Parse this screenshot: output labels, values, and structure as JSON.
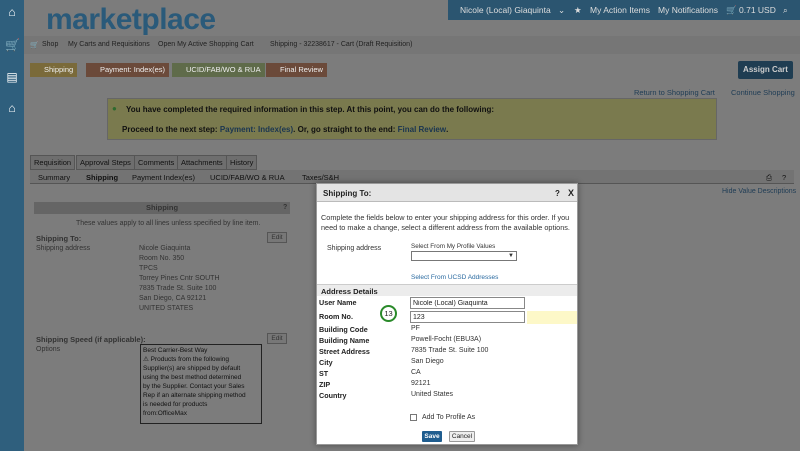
{
  "app": {
    "logo": "marketplace"
  },
  "topbar": {
    "user": "Nicole (Local) Giaquinta",
    "action_items": "My Action Items",
    "notifications": "My Notifications",
    "cart_total": "0.71 USD"
  },
  "nav": {
    "shop": "Shop",
    "carts": "My Carts and Requisitions",
    "open_cart": "Open My Active Shopping Cart",
    "breadcrumb": "Shipping - 32238617 - Cart (Draft Requisition)"
  },
  "steps": [
    "Shipping",
    "Payment: Index(es)",
    "UCID/FAB/WO & RUA",
    "Final Review"
  ],
  "assign_cart": "Assign Cart",
  "links": {
    "return": "Return to Shopping Cart",
    "continue": "Continue Shopping"
  },
  "notice": {
    "line1": "You have completed the required information in this step. At this point, you can do the following:",
    "line2_prefix": "Proceed to the next step:",
    "line2_link1": "Payment: Index(es)",
    "line2_mid": ". Or, go straight to the end:",
    "line2_link2": "Final Review",
    "line2_end": "."
  },
  "tabs_main": [
    "Requisition",
    "Approval Steps",
    "Comments",
    "Attachments",
    "History"
  ],
  "tabs_sub": [
    "Summary",
    "Shipping",
    "Payment Index(es)",
    "UCID/FAB/WO & RUA",
    "Taxes/S&H"
  ],
  "hide_desc": "Hide Value Descriptions",
  "left_panel": {
    "header": "Shipping",
    "header_q": "?",
    "subnote": "These values apply to all lines unless specified by line item.",
    "ship_to_title": "Shipping To:",
    "ship_addr_label": "Shipping address",
    "address": [
      "Nicole Giaquinta",
      "Room No. 350",
      "TPCS",
      "Torrey Pines Cntr SOUTH",
      "7835 Trade St. Suite 100",
      "San Diego, CA 92121",
      "UNITED STATES"
    ],
    "edit": "Edit",
    "speed_title": "Shipping Speed (if applicable):",
    "options_label": "Options",
    "speed_lines": [
      "Best Carrier-Best Way",
      "Products from the following",
      "Supplier(s) are shipped by default",
      "using the best method determined",
      "by the Supplier. Contact your Sales",
      "Rep if an alternate shipping method",
      "is needed for products",
      "from:OfficeMax"
    ]
  },
  "modal": {
    "title": "Shipping To:",
    "help": "?",
    "close": "X",
    "intro": "Complete the fields below to enter your shipping address for this order. If you need to make a change, select a different address from the available options.",
    "shipping_address_label": "Shipping address",
    "profile_values_label": "Select From My Profile Values",
    "ucsd_link": "Select From UCSD Addresses",
    "address_details": "Address Details",
    "fields": [
      {
        "label": "User Name",
        "value": "Nicole (Local) Giaquinta"
      },
      {
        "label": "Room No.",
        "value": "123"
      },
      {
        "label": "Building Code",
        "value": "PF"
      },
      {
        "label": "Building Name",
        "value": "Powell-Focht (EBU3A)"
      },
      {
        "label": "Street Address",
        "value": "7835 Trade St. Suite 100"
      },
      {
        "label": "City",
        "value": "San Diego"
      },
      {
        "label": "ST",
        "value": "CA"
      },
      {
        "label": "ZIP",
        "value": "92121"
      },
      {
        "label": "Country",
        "value": "United States"
      }
    ],
    "badge": "13",
    "add_profile": "Add To Profile As",
    "save": "Save",
    "cancel": "Cancel"
  }
}
